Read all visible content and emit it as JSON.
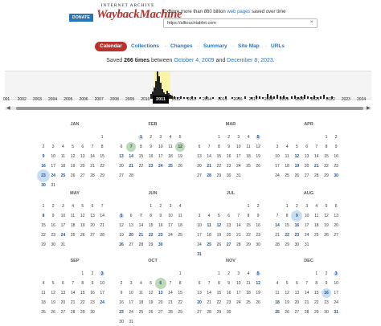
{
  "header": {
    "donate_label": "DONATE",
    "logo_top": "INTERNET ARCHIVE",
    "logo_main": "WaybackMachine",
    "explore_prefix": "Explore more than 860 billion",
    "explore_link": "web pages",
    "explore_suffix": "saved over time",
    "url_value": "https://alltouchtablet.com",
    "clear_icon": "×"
  },
  "nav": {
    "items": [
      "Calendar",
      "Collections",
      "Changes",
      "Summary",
      "Site Map",
      "URLs"
    ],
    "separator": "·"
  },
  "saved": {
    "prefix": "Saved",
    "count": "266 times",
    "between": "between",
    "start": "October 4, 2009",
    "and": "and",
    "end": "December 8, 2023",
    "dot": "."
  },
  "timeline": {
    "years": [
      "001",
      "2002",
      "2003",
      "2004",
      "2005",
      "2006",
      "2007",
      "2008",
      "2009",
      "2010",
      "2011",
      "2012",
      "2013",
      "2014",
      "2015",
      "2016",
      "2017",
      "2018",
      "2019",
      "2020",
      "2021",
      "2022",
      "2023",
      "2024"
    ],
    "selected_year": "2011",
    "left_arrow": "◀",
    "right_arrow": "▶"
  },
  "colors": {
    "accent": "#b8332e",
    "link": "#2b74b8",
    "capture_green": "#bcd8b5",
    "capture_blue": "#c9ddf2"
  },
  "months": [
    {
      "name": "JAN",
      "offset": 6,
      "days": 31,
      "cap": [
        9,
        16,
        23,
        24,
        25,
        30
      ],
      "bub": [
        {
          "d": 23,
          "c": "blue",
          "s": 8
        }
      ]
    },
    {
      "name": "FEB",
      "offset": 2,
      "days": 28,
      "cap": [
        1,
        7,
        12,
        13,
        14,
        21,
        23,
        24,
        25
      ],
      "bub": [
        {
          "d": 1,
          "c": "blue",
          "s": 3
        },
        {
          "d": 7,
          "c": "green",
          "s": 6
        },
        {
          "d": 12,
          "c": "green",
          "s": 6
        }
      ]
    },
    {
      "name": "MAR",
      "offset": 2,
      "days": 31,
      "cap": [
        5,
        21,
        28
      ],
      "bub": [
        {
          "d": 5,
          "c": "blue",
          "s": 3
        }
      ]
    },
    {
      "name": "APR",
      "offset": 5,
      "days": 30,
      "cap": [
        12,
        19,
        21,
        30
      ],
      "bub": []
    },
    {
      "name": "MAY",
      "offset": 0,
      "days": 31,
      "cap": [
        8,
        24
      ],
      "bub": []
    },
    {
      "name": "JUN",
      "offset": 3,
      "days": 30,
      "cap": [
        5,
        7,
        20,
        21,
        22,
        23,
        26,
        30
      ],
      "bub": [
        {
          "d": 5,
          "c": "blue",
          "s": 3
        }
      ]
    },
    {
      "name": "JUL",
      "offset": 5,
      "days": 31,
      "cap": [
        11,
        12,
        25,
        27,
        31
      ],
      "bub": []
    },
    {
      "name": "AUG",
      "offset": 1,
      "days": 31,
      "cap": [
        9,
        14,
        16,
        22,
        23
      ],
      "bub": [
        {
          "d": 9,
          "c": "blue",
          "s": 7
        }
      ]
    },
    {
      "name": "SEP",
      "offset": 4,
      "days": 30,
      "cap": [
        3,
        24
      ],
      "bub": [
        {
          "d": 3,
          "c": "blue",
          "s": 3
        }
      ]
    },
    {
      "name": "OCT",
      "offset": 6,
      "days": 31,
      "cap": [
        6,
        13,
        23
      ],
      "bub": [
        {
          "d": 6,
          "c": "green",
          "s": 7
        }
      ]
    },
    {
      "name": "NOV",
      "offset": 2,
      "days": 30,
      "cap": [
        5,
        12,
        20
      ],
      "bub": [
        {
          "d": 5,
          "c": "blue",
          "s": 3
        }
      ]
    },
    {
      "name": "DEC",
      "offset": 4,
      "days": 31,
      "cap": [
        3,
        16,
        18,
        25,
        31
      ],
      "bub": [
        {
          "d": 3,
          "c": "blue",
          "s": 3
        },
        {
          "d": 16,
          "c": "blue",
          "s": 6
        }
      ]
    }
  ]
}
